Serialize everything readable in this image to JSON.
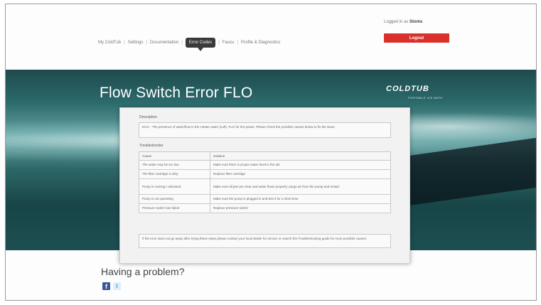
{
  "header": {
    "nav_items": [
      "My ColdTub",
      "Settings",
      "Documentation",
      "Error Codes",
      "Faucu",
      "Profile & Diagnostics"
    ],
    "active_index": 3,
    "login_prefix": "Logged in as",
    "login_user": "Stoms",
    "logout_label": "Logout"
  },
  "hero": {
    "title": "Flow Switch Error FLO",
    "brand": "COLDTUB",
    "brand_sub": "PORTABLE ICE BATH"
  },
  "panel": {
    "description_label": "Description",
    "description_text": "Error - The presence of water/flow in the Heater water (Loft). FLO for the power. Please check the possible causes below to fix the issue.",
    "troubleshoot_label": "Troubleshooter",
    "table_headers": [
      "Cause",
      "Solution"
    ],
    "rows": [
      [
        "The water may be too low",
        "Make sure there is proper water level in the tub"
      ],
      [
        "The filter cartridge is dirty",
        "Replace filter cartridge"
      ],
      [
        "Pump is running / airlocked",
        "Make sure all jets are clear and water flows properly; purge air from the pump and restart"
      ],
      [
        "Pump is not operating",
        "Make sure the pump is plugged in and test it for a short time"
      ],
      [
        "Pressure switch has failed",
        "Replace pressure switch"
      ]
    ],
    "note_text": "If the error does not go away after trying these steps please contact your local dealer for service or search the Troubleshooting guide for more possible causes."
  },
  "footer": {
    "problem_heading": "Having a problem?",
    "facebook_glyph": "f",
    "twitter_glyph": "t"
  },
  "colors": {
    "logout": "#d9302c",
    "hero_teal": "#2b6a6b",
    "active_nav": "#3a3a3a"
  }
}
